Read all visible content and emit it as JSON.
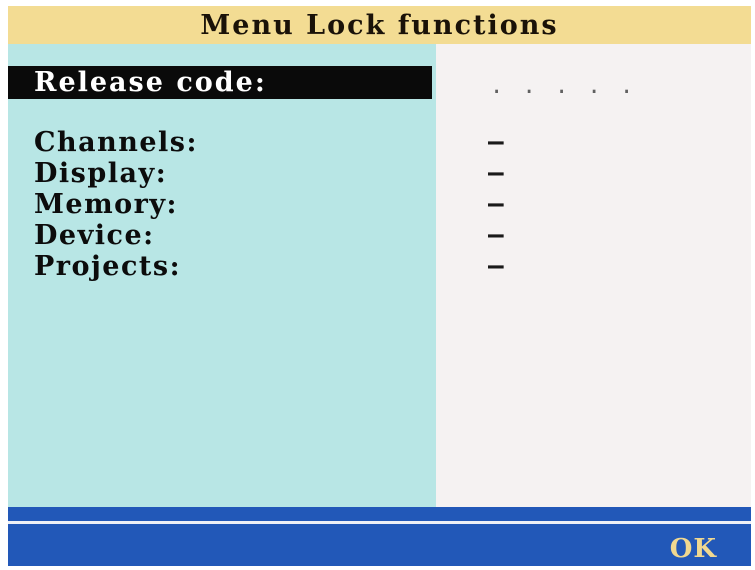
{
  "window": {
    "title": "Menu Lock functions"
  },
  "release": {
    "label": "Release code:",
    "value": ". . . . ."
  },
  "locks": [
    {
      "label": "Channels:",
      "value": "—"
    },
    {
      "label": "Display:",
      "value": "—"
    },
    {
      "label": "Memory:",
      "value": "—"
    },
    {
      "label": "Device:",
      "value": "—"
    },
    {
      "label": "Projects:",
      "value": "—"
    }
  ],
  "footer": {
    "ok_label": "OK"
  },
  "colors": {
    "title_bar": "#f3dc93",
    "left_pane": "#b8e6e5",
    "right_pane": "#f5f2f2",
    "selection": "#0a0a0a",
    "footer_bar": "#2258b8",
    "ok_text": "#f0d890"
  }
}
